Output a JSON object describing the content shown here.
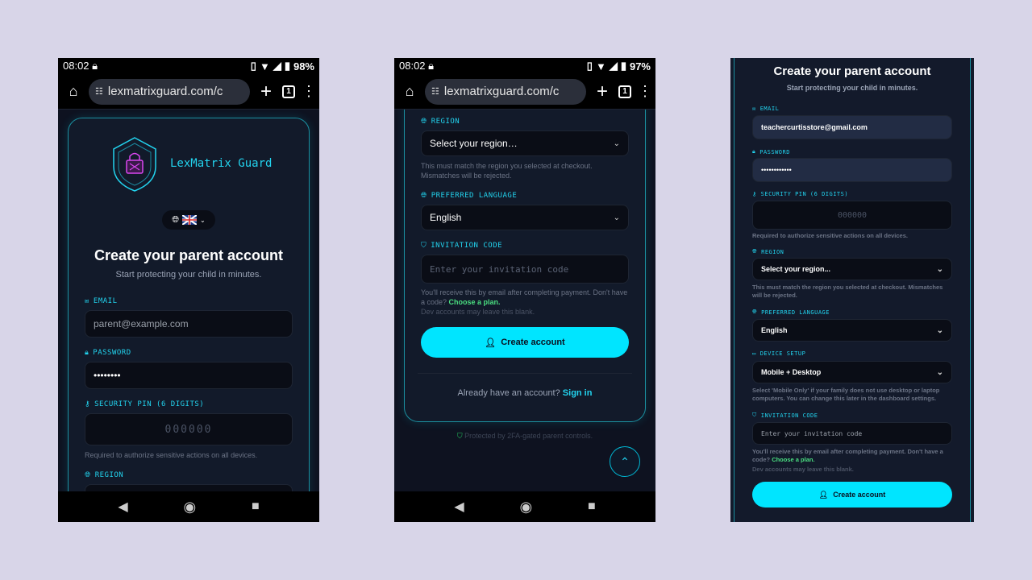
{
  "status1": {
    "time": "08:02",
    "battery": "98%"
  },
  "status2": {
    "time": "08:02",
    "battery": "97%"
  },
  "browser": {
    "url": "lexmatrixguard.com/c",
    "tab_count": "1"
  },
  "brand": {
    "name": "LexMatrix Guard"
  },
  "form": {
    "title": "Create your parent account",
    "subtitle": "Start protecting your child in minutes.",
    "email_label": "EMAIL",
    "email_placeholder": "parent@example.com",
    "email_value": "teachercurtisstore@gmail.com",
    "password_label": "PASSWORD",
    "password_masked_short": "••••••••",
    "password_masked_long": "••••••••••••",
    "pin_label": "SECURITY PIN (6 DIGITS)",
    "pin_placeholder": "000000",
    "pin_hint": "Required to authorize sensitive actions on all devices.",
    "region_label": "REGION",
    "region_value": "Select your region...",
    "region_value_alt": "Select your region…",
    "region_hint": "This must match the region you selected at checkout. Mismatches will be rejected.",
    "lang_label": "PREFERRED LANGUAGE",
    "lang_value": "English",
    "device_label": "DEVICE SETUP",
    "device_value": "Mobile + Desktop",
    "device_hint": "Select 'Mobile Only' if your family does not use desktop or laptop computers. You can change this later in the dashboard settings.",
    "invite_label": "INVITATION CODE",
    "invite_placeholder": "Enter your invitation code",
    "invite_hint": "You'll receive this by email after completing payment. Don't have a code?",
    "invite_link": "Choose a plan.",
    "dev_hint": "Dev accounts may leave this blank.",
    "submit": "Create account",
    "signin_prompt": "Already have an account?",
    "signin_link": "Sign in",
    "footer": "Protected by 2FA-gated parent controls."
  },
  "colors": {
    "accent": "#00e5ff",
    "link_green": "#4ade80",
    "background": "#d8d5e8"
  }
}
